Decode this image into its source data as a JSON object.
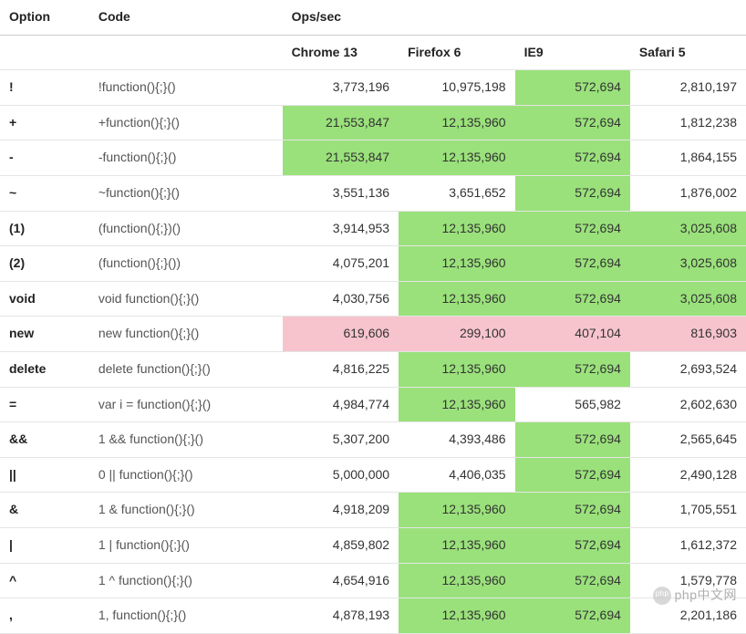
{
  "headers": {
    "option": "Option",
    "code": "Code",
    "ops": "Ops/sec",
    "browsers": [
      "Chrome 13",
      "Firefox 6",
      "IE9",
      "Safari 5"
    ]
  },
  "rows": [
    {
      "option": "!",
      "code": "!function(){;}()",
      "cells": [
        {
          "v": "3,773,196",
          "hl": ""
        },
        {
          "v": "10,975,198",
          "hl": ""
        },
        {
          "v": "572,694",
          "hl": "green"
        },
        {
          "v": "2,810,197",
          "hl": ""
        }
      ]
    },
    {
      "option": "+",
      "code": "+function(){;}()",
      "cells": [
        {
          "v": "21,553,847",
          "hl": "green"
        },
        {
          "v": "12,135,960",
          "hl": "green"
        },
        {
          "v": "572,694",
          "hl": "green"
        },
        {
          "v": "1,812,238",
          "hl": ""
        }
      ]
    },
    {
      "option": "-",
      "code": "-function(){;}()",
      "cells": [
        {
          "v": "21,553,847",
          "hl": "green"
        },
        {
          "v": "12,135,960",
          "hl": "green"
        },
        {
          "v": "572,694",
          "hl": "green"
        },
        {
          "v": "1,864,155",
          "hl": ""
        }
      ]
    },
    {
      "option": "~",
      "code": "~function(){;}()",
      "cells": [
        {
          "v": "3,551,136",
          "hl": ""
        },
        {
          "v": "3,651,652",
          "hl": ""
        },
        {
          "v": "572,694",
          "hl": "green"
        },
        {
          "v": "1,876,002",
          "hl": ""
        }
      ]
    },
    {
      "option": "(1)",
      "code": "(function(){;})()",
      "cells": [
        {
          "v": "3,914,953",
          "hl": ""
        },
        {
          "v": "12,135,960",
          "hl": "green"
        },
        {
          "v": "572,694",
          "hl": "green"
        },
        {
          "v": "3,025,608",
          "hl": "green"
        }
      ]
    },
    {
      "option": "(2)",
      "code": "(function(){;}())",
      "cells": [
        {
          "v": "4,075,201",
          "hl": ""
        },
        {
          "v": "12,135,960",
          "hl": "green"
        },
        {
          "v": "572,694",
          "hl": "green"
        },
        {
          "v": "3,025,608",
          "hl": "green"
        }
      ]
    },
    {
      "option": "void",
      "code": "void function(){;}()",
      "cells": [
        {
          "v": "4,030,756",
          "hl": ""
        },
        {
          "v": "12,135,960",
          "hl": "green"
        },
        {
          "v": "572,694",
          "hl": "green"
        },
        {
          "v": "3,025,608",
          "hl": "green"
        }
      ]
    },
    {
      "option": "new",
      "code": "new function(){;}()",
      "cells": [
        {
          "v": "619,606",
          "hl": "pink"
        },
        {
          "v": "299,100",
          "hl": "pink"
        },
        {
          "v": "407,104",
          "hl": "pink"
        },
        {
          "v": "816,903",
          "hl": "pink"
        }
      ]
    },
    {
      "option": "delete",
      "code": "delete function(){;}()",
      "cells": [
        {
          "v": "4,816,225",
          "hl": ""
        },
        {
          "v": "12,135,960",
          "hl": "green"
        },
        {
          "v": "572,694",
          "hl": "green"
        },
        {
          "v": "2,693,524",
          "hl": ""
        }
      ]
    },
    {
      "option": "=",
      "code": "var i = function(){;}()",
      "cells": [
        {
          "v": "4,984,774",
          "hl": ""
        },
        {
          "v": "12,135,960",
          "hl": "green"
        },
        {
          "v": "565,982",
          "hl": ""
        },
        {
          "v": "2,602,630",
          "hl": ""
        }
      ]
    },
    {
      "option": "&&",
      "code": "1 && function(){;}()",
      "cells": [
        {
          "v": "5,307,200",
          "hl": ""
        },
        {
          "v": "4,393,486",
          "hl": ""
        },
        {
          "v": "572,694",
          "hl": "green"
        },
        {
          "v": "2,565,645",
          "hl": ""
        }
      ]
    },
    {
      "option": "||",
      "code": "0 || function(){;}()",
      "cells": [
        {
          "v": "5,000,000",
          "hl": ""
        },
        {
          "v": "4,406,035",
          "hl": ""
        },
        {
          "v": "572,694",
          "hl": "green"
        },
        {
          "v": "2,490,128",
          "hl": ""
        }
      ]
    },
    {
      "option": "&",
      "code": "1 & function(){;}()",
      "cells": [
        {
          "v": "4,918,209",
          "hl": ""
        },
        {
          "v": "12,135,960",
          "hl": "green"
        },
        {
          "v": "572,694",
          "hl": "green"
        },
        {
          "v": "1,705,551",
          "hl": ""
        }
      ]
    },
    {
      "option": "|",
      "code": "1 | function(){;}()",
      "cells": [
        {
          "v": "4,859,802",
          "hl": ""
        },
        {
          "v": "12,135,960",
          "hl": "green"
        },
        {
          "v": "572,694",
          "hl": "green"
        },
        {
          "v": "1,612,372",
          "hl": ""
        }
      ]
    },
    {
      "option": "^",
      "code": "1 ^ function(){;}()",
      "cells": [
        {
          "v": "4,654,916",
          "hl": ""
        },
        {
          "v": "12,135,960",
          "hl": "green"
        },
        {
          "v": "572,694",
          "hl": "green"
        },
        {
          "v": "1,579,778",
          "hl": ""
        }
      ]
    },
    {
      "option": ",",
      "code": "1, function(){;}()",
      "cells": [
        {
          "v": "4,878,193",
          "hl": ""
        },
        {
          "v": "12,135,960",
          "hl": "green"
        },
        {
          "v": "572,694",
          "hl": "green"
        },
        {
          "v": "2,201,186",
          "hl": ""
        }
      ]
    }
  ],
  "watermark": "php中文网",
  "chart_data": {
    "type": "table",
    "title": "Ops/sec",
    "columns": [
      "Option",
      "Code",
      "Chrome 13",
      "Firefox 6",
      "IE9",
      "Safari 5"
    ],
    "rows": [
      [
        "!",
        "!function(){;}()",
        3773196,
        10975198,
        572694,
        2810197
      ],
      [
        "+",
        "+function(){;}()",
        21553847,
        12135960,
        572694,
        1812238
      ],
      [
        "-",
        "-function(){;}()",
        21553847,
        12135960,
        572694,
        1864155
      ],
      [
        "~",
        "~function(){;}()",
        3551136,
        3651652,
        572694,
        1876002
      ],
      [
        "(1)",
        "(function(){;})()",
        3914953,
        12135960,
        572694,
        3025608
      ],
      [
        "(2)",
        "(function(){;}())",
        4075201,
        12135960,
        572694,
        3025608
      ],
      [
        "void",
        "void function(){;}()",
        4030756,
        12135960,
        572694,
        3025608
      ],
      [
        "new",
        "new function(){;}()",
        619606,
        299100,
        407104,
        816903
      ],
      [
        "delete",
        "delete function(){;}()",
        4816225,
        12135960,
        572694,
        2693524
      ],
      [
        "=",
        "var i = function(){;}()",
        4984774,
        12135960,
        565982,
        2602630
      ],
      [
        "&&",
        "1 && function(){;}()",
        5307200,
        4393486,
        572694,
        2565645
      ],
      [
        "||",
        "0 || function(){;}()",
        5000000,
        4406035,
        572694,
        2490128
      ],
      [
        "&",
        "1 & function(){;}()",
        4918209,
        12135960,
        572694,
        1705551
      ],
      [
        "|",
        "1 | function(){;}()",
        4859802,
        12135960,
        572694,
        1612372
      ],
      [
        "^",
        "1 ^ function(){;}()",
        4654916,
        12135960,
        572694,
        1579778
      ],
      [
        ",",
        "1, function(){;}()",
        4878193,
        12135960,
        572694,
        2201186
      ]
    ]
  }
}
